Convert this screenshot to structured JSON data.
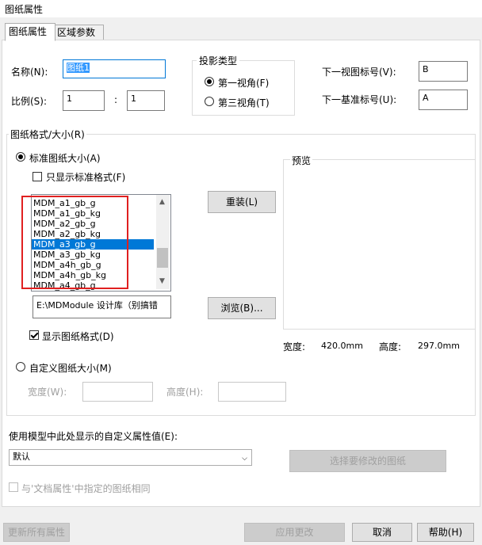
{
  "window": {
    "title": "图纸属性"
  },
  "tabs": [
    {
      "label": "图纸属性"
    },
    {
      "label": "区域参数"
    }
  ],
  "name": {
    "label": "名称(N):",
    "value": "图纸1"
  },
  "scale": {
    "label": "比例(S):",
    "numerator": "1",
    "separator": ":",
    "denominator": "1"
  },
  "projection": {
    "title": "投影类型",
    "first_angle": "第一视角(F)",
    "third_angle": "第三视角(T)",
    "selected": "first_angle"
  },
  "next_view_label": {
    "label": "下一视图标号(V):",
    "value": "B"
  },
  "next_datum_label": {
    "label": "下一基准标号(U):",
    "value": "A"
  },
  "sheet_format": {
    "title": "图纸格式/大小(R)",
    "standard_label": "标准图纸大小(A)",
    "only_standard_label": "只显示标准格式(F)",
    "items": [
      "MDM_a1_gb_g",
      "MDM_a1_gb_kg",
      "MDM_a2_gb_g",
      "MDM_a2_gb_kg",
      "MDM_a3_gb_g",
      "MDM_a3_gb_kg",
      "MDM_a4h_gb_g",
      "MDM_a4h_gb_kg",
      "MDM_a4_gb_g"
    ],
    "selected_index": 4,
    "reload_button": "重装(L)",
    "path_value": "E:\\MDModule 设计库（别搞错",
    "browse_button": "浏览(B)...",
    "show_format_label": "显示图纸格式(D)",
    "preview_label": "预览",
    "width_label": "宽度:",
    "width_value": "420.0mm",
    "height_label": "高度:",
    "height_value": "297.0mm",
    "custom_label": "自定义图纸大小(M)",
    "custom_width_label": "宽度(W):",
    "custom_height_label": "高度(H):"
  },
  "custom_props": {
    "label": "使用模型中此处显示的自定义属性值(E):",
    "dropdown_value": "默认",
    "select_sheets_button": "选择要修改的图纸",
    "same_as_doc_label": "与'文档属性'中指定的图纸相同"
  },
  "footer": {
    "update_all": "更新所有属性",
    "apply": "应用更改",
    "cancel": "取消",
    "help": "帮助(H)"
  }
}
